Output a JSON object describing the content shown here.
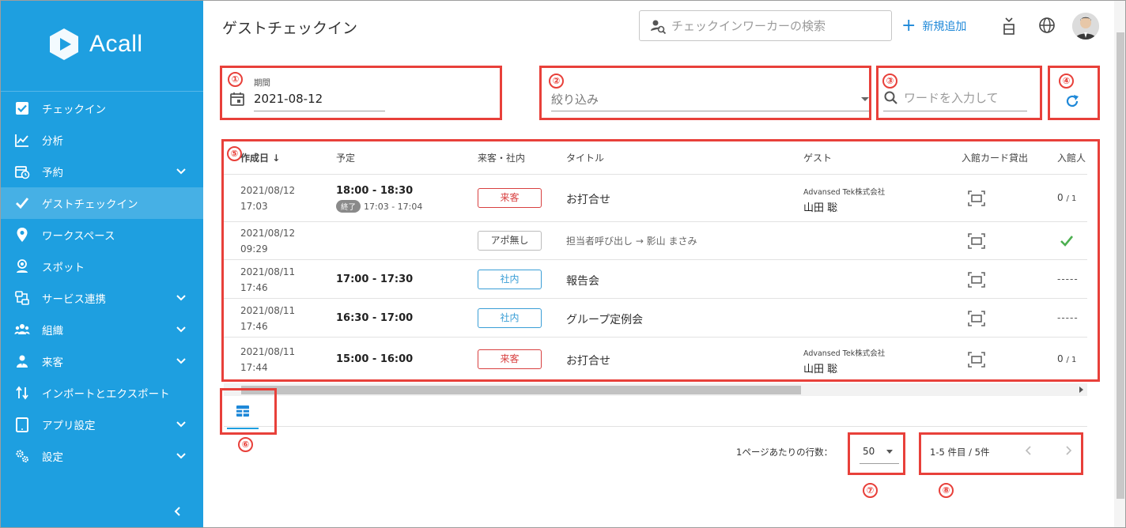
{
  "app": {
    "logo_text": "Acall",
    "brand_color": "#1e9fe0",
    "accent_color": "#1e88d8",
    "annotation_color": "#e8403a"
  },
  "sidebar": {
    "items": [
      {
        "label": "チェックイン",
        "icon": "checkbox-icon",
        "has_chevron": false,
        "active": false
      },
      {
        "label": "分析",
        "icon": "chart-line-icon",
        "has_chevron": false,
        "active": false
      },
      {
        "label": "予約",
        "icon": "calendar-clock-icon",
        "has_chevron": true,
        "active": false
      },
      {
        "label": "ゲストチェックイン",
        "icon": "check-icon",
        "has_chevron": false,
        "active": true
      },
      {
        "label": "ワークスペース",
        "icon": "location-pin-icon",
        "has_chevron": false,
        "active": false
      },
      {
        "label": "スポット",
        "icon": "person-pin-icon",
        "has_chevron": false,
        "active": false
      },
      {
        "label": "サービス連携",
        "icon": "integration-icon",
        "has_chevron": true,
        "active": false
      },
      {
        "label": "組織",
        "icon": "group-icon",
        "has_chevron": true,
        "active": false
      },
      {
        "label": "来客",
        "icon": "visitor-icon",
        "has_chevron": true,
        "active": false
      },
      {
        "label": "インポートとエクスポート",
        "icon": "import-export-icon",
        "has_chevron": false,
        "active": false
      },
      {
        "label": "アプリ設定",
        "icon": "tablet-icon",
        "has_chevron": true,
        "active": false
      },
      {
        "label": "設定",
        "icon": "gears-icon",
        "has_chevron": true,
        "active": false
      }
    ]
  },
  "header": {
    "title": "ゲストチェックイン",
    "search_placeholder": "チェックインワーカーの検索",
    "add_label": "新規追加"
  },
  "filters": {
    "period_label": "期間",
    "period_value": "2021-08-12",
    "filter_placeholder": "絞り込み",
    "word_placeholder": "ワードを入力して"
  },
  "table": {
    "columns": [
      "作成日",
      "予定",
      "来客・社内",
      "タイトル",
      "ゲスト",
      "入館カード貸出",
      "入館人"
    ],
    "rows": [
      {
        "created_date": "2021/08/12",
        "created_time": "17:03",
        "schedule": "18:00 - 18:30",
        "done_tag": "終了",
        "done_time": "17:03 - 17:04",
        "type": "来客",
        "type_style": "red",
        "title": "お打合せ",
        "guest_company": "Advansed Tek株式会社",
        "guest_name": "山田 聡",
        "entry": "0",
        "entry_total": "/ 1",
        "entry_kind": "count"
      },
      {
        "created_date": "2021/08/12",
        "created_time": "09:29",
        "schedule": "",
        "done_tag": "",
        "done_time": "",
        "type": "アポ無し",
        "type_style": "gray",
        "title": "担当者呼び出し → 影山 まさみ",
        "guest_company": "",
        "guest_name": "",
        "entry": "",
        "entry_total": "",
        "entry_kind": "check"
      },
      {
        "created_date": "2021/08/11",
        "created_time": "17:46",
        "schedule": "17:00 - 17:30",
        "done_tag": "",
        "done_time": "",
        "type": "社内",
        "type_style": "blue",
        "title": "報告会",
        "guest_company": "",
        "guest_name": "",
        "entry": "-----",
        "entry_total": "",
        "entry_kind": "dash"
      },
      {
        "created_date": "2021/08/11",
        "created_time": "17:46",
        "schedule": "16:30 - 17:00",
        "done_tag": "",
        "done_time": "",
        "type": "社内",
        "type_style": "blue",
        "title": "グループ定例会",
        "guest_company": "",
        "guest_name": "",
        "entry": "-----",
        "entry_total": "",
        "entry_kind": "dash"
      },
      {
        "created_date": "2021/08/11",
        "created_time": "17:44",
        "schedule": "15:00 - 16:00",
        "done_tag": "",
        "done_time": "",
        "type": "来客",
        "type_style": "red",
        "title": "お打合せ",
        "guest_company": "Advansed Tek株式会社",
        "guest_name": "山田 聡",
        "entry": "0",
        "entry_total": "/ 1",
        "entry_kind": "count"
      }
    ]
  },
  "pagination": {
    "rows_per_page_label": "1ページあたりの行数：",
    "rows_per_page": "50",
    "range": "1-5 件目 / 5件"
  },
  "annotations": [
    "①",
    "②",
    "③",
    "④",
    "⑤",
    "⑥",
    "⑦",
    "⑧"
  ]
}
